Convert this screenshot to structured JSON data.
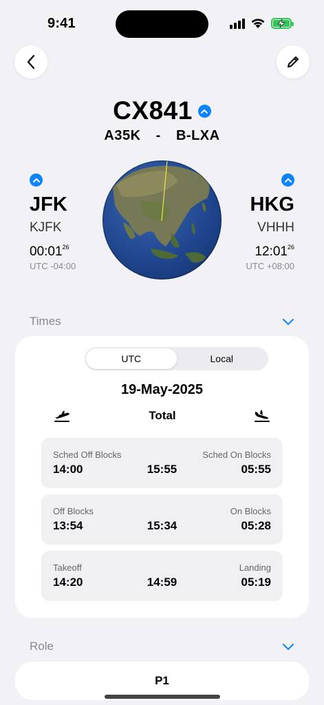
{
  "status": {
    "time": "9:41"
  },
  "nav": {
    "back_icon": "chevron-left-icon",
    "edit_icon": "pencil-icon"
  },
  "flight": {
    "number": "CX841",
    "aircraft_type": "A35K",
    "separator": "-",
    "registration": "B-LXA"
  },
  "departure": {
    "iata": "JFK",
    "icao": "KJFK",
    "time": "00:01",
    "seconds": "26",
    "utc_offset": "UTC -04:00"
  },
  "arrival": {
    "iata": "HKG",
    "icao": "VHHH",
    "time": "12:01",
    "seconds": "26",
    "utc_offset": "UTC +08:00"
  },
  "colors": {
    "accent": "#0a84ff",
    "background": "#f2f1f6",
    "card": "#ffffff",
    "row": "#f0f0f3",
    "route_line": "#e8e84a"
  },
  "times": {
    "section_label": "Times",
    "segments": [
      "UTC",
      "Local"
    ],
    "selected_segment": "UTC",
    "date": "19-May-2025",
    "total_label": "Total",
    "rows": [
      {
        "left_label": "Sched Off Blocks",
        "left_value": "14:00",
        "center_value": "15:55",
        "right_label": "Sched On Blocks",
        "right_value": "05:55"
      },
      {
        "left_label": "Off Blocks",
        "left_value": "13:54",
        "center_value": "15:34",
        "right_label": "On Blocks",
        "right_value": "05:28"
      },
      {
        "left_label": "Takeoff",
        "left_value": "14:20",
        "center_value": "14:59",
        "right_label": "Landing",
        "right_value": "05:19"
      }
    ]
  },
  "role": {
    "section_label": "Role",
    "value": "P1"
  }
}
